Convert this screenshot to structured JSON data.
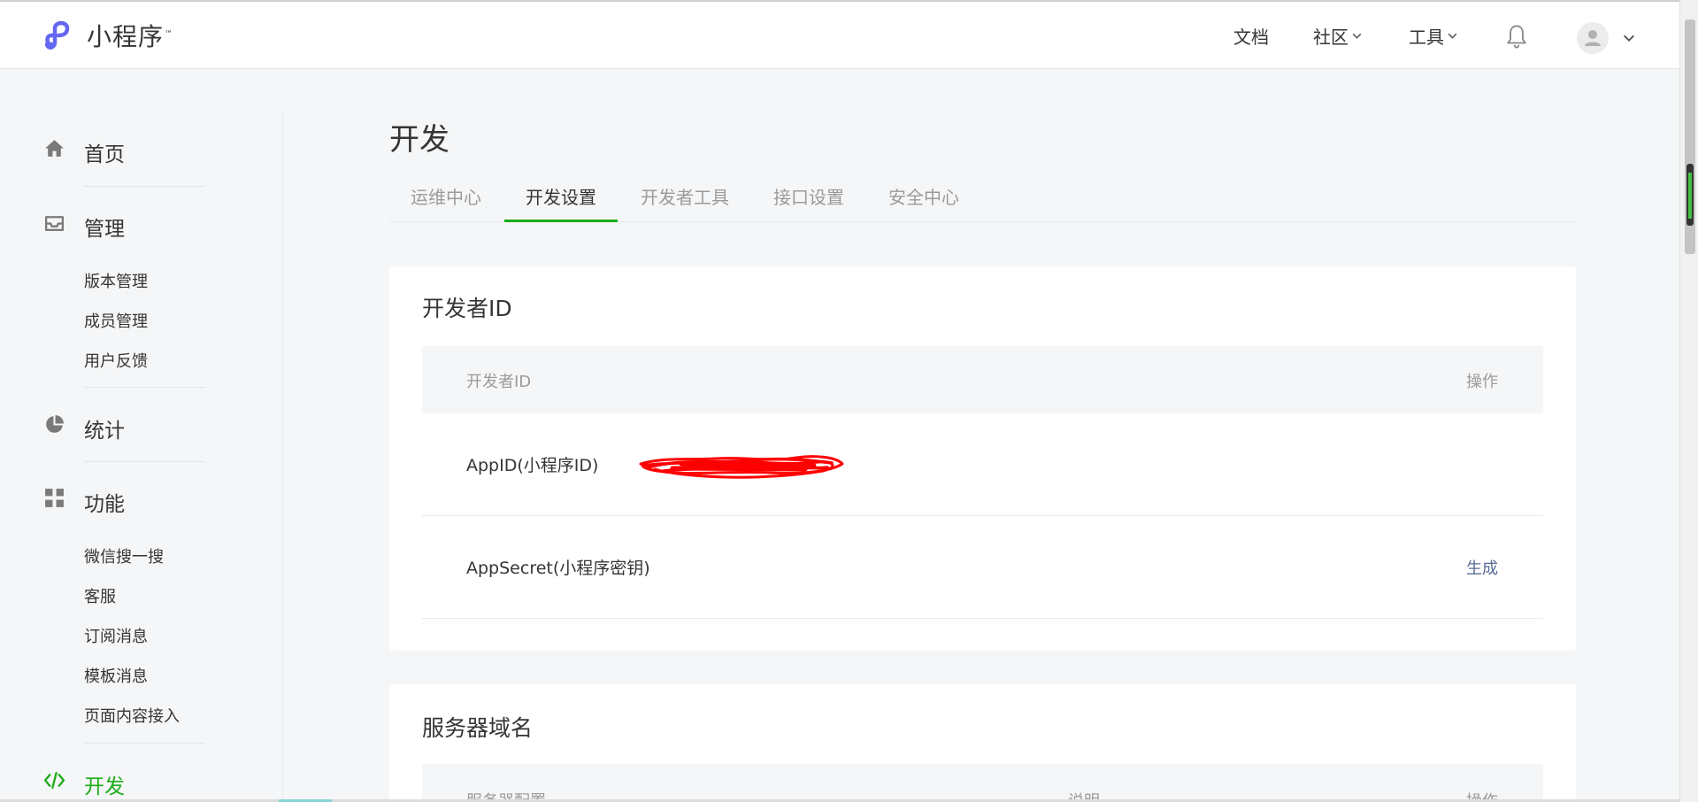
{
  "header": {
    "logo_text": "小程序",
    "logo_tm": "™",
    "nav": [
      {
        "label": "文档"
      },
      {
        "label": "社区"
      },
      {
        "label": "工具"
      }
    ]
  },
  "sidebar": {
    "home": {
      "label": "首页"
    },
    "manage": {
      "label": "管理",
      "items": [
        {
          "label": "版本管理"
        },
        {
          "label": "成员管理"
        },
        {
          "label": "用户反馈"
        }
      ]
    },
    "stats": {
      "label": "统计"
    },
    "features": {
      "label": "功能",
      "items": [
        {
          "label": "微信搜一搜"
        },
        {
          "label": "客服"
        },
        {
          "label": "订阅消息"
        },
        {
          "label": "模板消息"
        },
        {
          "label": "页面内容接入"
        }
      ]
    },
    "dev": {
      "label": "开发"
    }
  },
  "main": {
    "title": "开发",
    "tabs": [
      {
        "label": "运维中心"
      },
      {
        "label": "开发设置"
      },
      {
        "label": "开发者工具"
      },
      {
        "label": "接口设置"
      },
      {
        "label": "安全中心"
      }
    ],
    "active_tab_index": 1,
    "dev_id_card": {
      "title": "开发者ID",
      "columns": {
        "id": "开发者ID",
        "action": "操作"
      },
      "rows": [
        {
          "name": "AppID(小程序ID)",
          "action": ""
        },
        {
          "name": "AppSecret(小程序密钥)",
          "action": "生成"
        }
      ]
    },
    "server_card": {
      "title": "服务器域名",
      "columns": {
        "config": "服务器配置",
        "desc": "说明",
        "action": "操作"
      }
    }
  },
  "colors": {
    "accent_green": "#1aad19",
    "link_blue": "#576b95",
    "logo_purple": "#6467f0",
    "redaction_red": "#ff0000"
  },
  "icons": {
    "home": "home-icon",
    "manage": "inbox-icon",
    "stats": "pie-chart-icon",
    "features": "grid-icon",
    "dev": "code-icon",
    "bell": "bell-icon",
    "avatar": "user-icon"
  }
}
